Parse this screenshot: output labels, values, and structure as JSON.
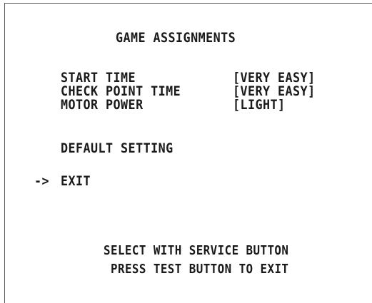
{
  "screen": {
    "title": "GAME ASSIGNMENTS",
    "settings": [
      {
        "label": "START TIME",
        "value": "[VERY EASY]"
      },
      {
        "label": "CHECK POINT TIME",
        "value": "[VERY EASY]"
      },
      {
        "label": "MOTOR POWER",
        "value": "[LIGHT]"
      }
    ],
    "default_setting_label": "DEFAULT SETTING",
    "cursor": "->",
    "exit_label": "EXIT",
    "instructions": [
      "SELECT WITH SERVICE BUTTON",
      "PRESS TEST BUTTON TO EXIT"
    ]
  },
  "colors": {
    "background": "#ffffff",
    "text": "#1a1a1a",
    "frame": "#555555"
  }
}
